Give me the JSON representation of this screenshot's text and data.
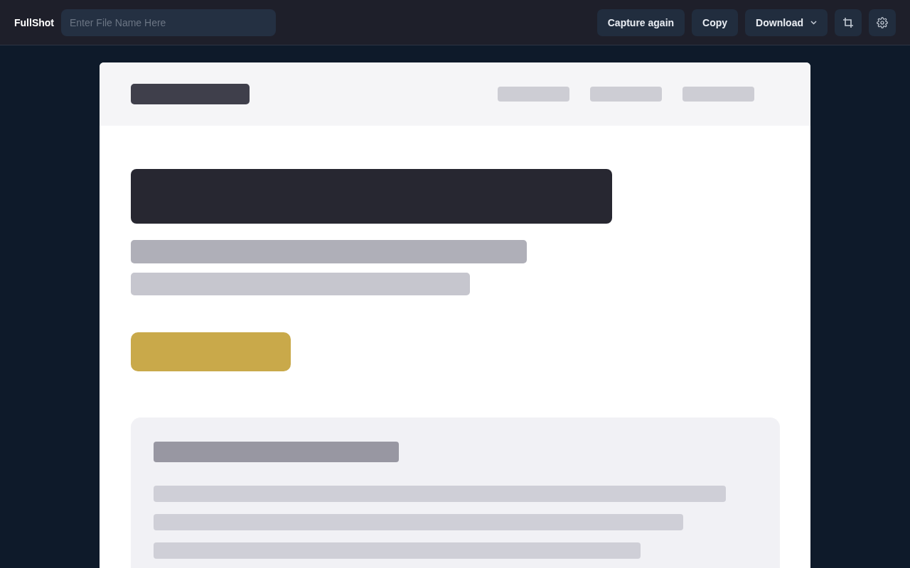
{
  "app": {
    "title": "FullShot"
  },
  "file_name": {
    "placeholder": "Enter File Name Here"
  },
  "buttons": [
    {
      "label": "Capture again",
      "kind": "text"
    },
    {
      "label": "Copy",
      "kind": "text"
    },
    {
      "label": "Download",
      "kind": "dropdown"
    },
    {
      "kind": "crop"
    },
    {
      "kind": "settings"
    }
  ]
}
